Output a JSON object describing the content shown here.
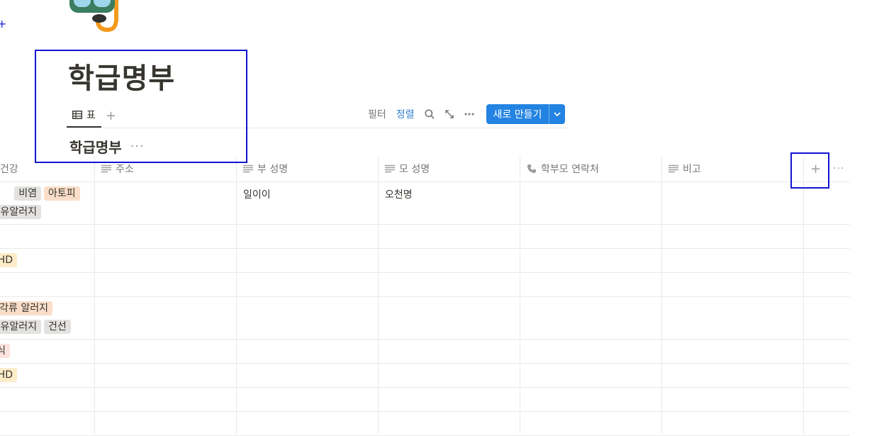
{
  "page": {
    "title": "학급명부"
  },
  "tabs": [
    {
      "label": "표"
    }
  ],
  "toolbar": {
    "filter": "필터",
    "sort": "정렬",
    "new_button": "새로 만들기"
  },
  "database": {
    "title": "학급명부"
  },
  "columns": [
    {
      "label": "건강",
      "icon": "multi-select-icon"
    },
    {
      "label": "주소",
      "icon": "text-icon"
    },
    {
      "label": "부 성명",
      "icon": "text-icon"
    },
    {
      "label": "모 성명",
      "icon": "text-icon"
    },
    {
      "label": "학부모 연락처",
      "icon": "phone-icon"
    },
    {
      "label": "비고",
      "icon": "text-icon"
    }
  ],
  "rows": [
    {
      "health_tags": [
        {
          "label": "비염",
          "color": "#e3e2e0"
        },
        {
          "label": "아토피",
          "color": "#fadec9"
        },
        {
          "label": "우유알러지",
          "color": "#e3e2e0"
        }
      ],
      "father": "일이이",
      "mother": "오천명"
    },
    {
      "health_tags": []
    },
    {
      "health_tags": [
        {
          "label": "ADHD",
          "color": "#fdecc8"
        }
      ]
    },
    {
      "health_tags": []
    },
    {
      "health_tags": [
        {
          "label": "갑각류 알러지",
          "color": "#fadec9"
        },
        {
          "label": "우유알러지",
          "color": "#e3e2e0"
        },
        {
          "label": "건선",
          "color": "#e3e2e0"
        }
      ]
    },
    {
      "health_tags": [
        {
          "label": "천식",
          "color": "#ffe2dd"
        }
      ]
    },
    {
      "health_tags": [
        {
          "label": "ADHD",
          "color": "#fdecc8"
        }
      ]
    },
    {
      "health_tags": []
    },
    {
      "health_tags": []
    }
  ],
  "colors": {
    "accent": "#2383e2",
    "highlight": "#1414d4"
  }
}
